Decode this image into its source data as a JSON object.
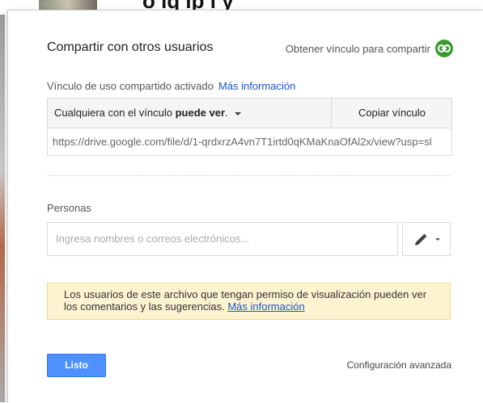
{
  "background": {
    "title_fragment": "o      iq     ip      i       y"
  },
  "dialog": {
    "title": "Compartir con otros usuarios",
    "get_link_label": "Obtener vínculo para compartir",
    "link_icon": "link-icon",
    "link_icon_color": "#3a9a2f"
  },
  "link_sharing": {
    "status": "Vínculo de uso compartido activado",
    "more_info": "Más información",
    "access_prefix": "Cualquiera con el vínculo ",
    "access_level": "puede ver",
    "access_suffix": ".",
    "copy_button": "Copiar vínculo",
    "url": "https://drive.google.com/file/d/1-qrdxrzA4vn7T1irtd0qKMaKnaOfAl2x/view?usp=sl"
  },
  "people": {
    "label": "Personas",
    "input_placeholder": "Ingresa nombres o correos electrónicos...",
    "permission_icon": "pencil-icon"
  },
  "notice": {
    "text": "Los usuarios de este archivo que tengan permiso de visualización pueden ver los comentarios y las sugerencias. ",
    "link": "Más información",
    "bg_color": "#fdf3d0"
  },
  "footer": {
    "done_button": "Listo",
    "done_color": "#4d90fe",
    "advanced_link": "Configuración avanzada"
  }
}
